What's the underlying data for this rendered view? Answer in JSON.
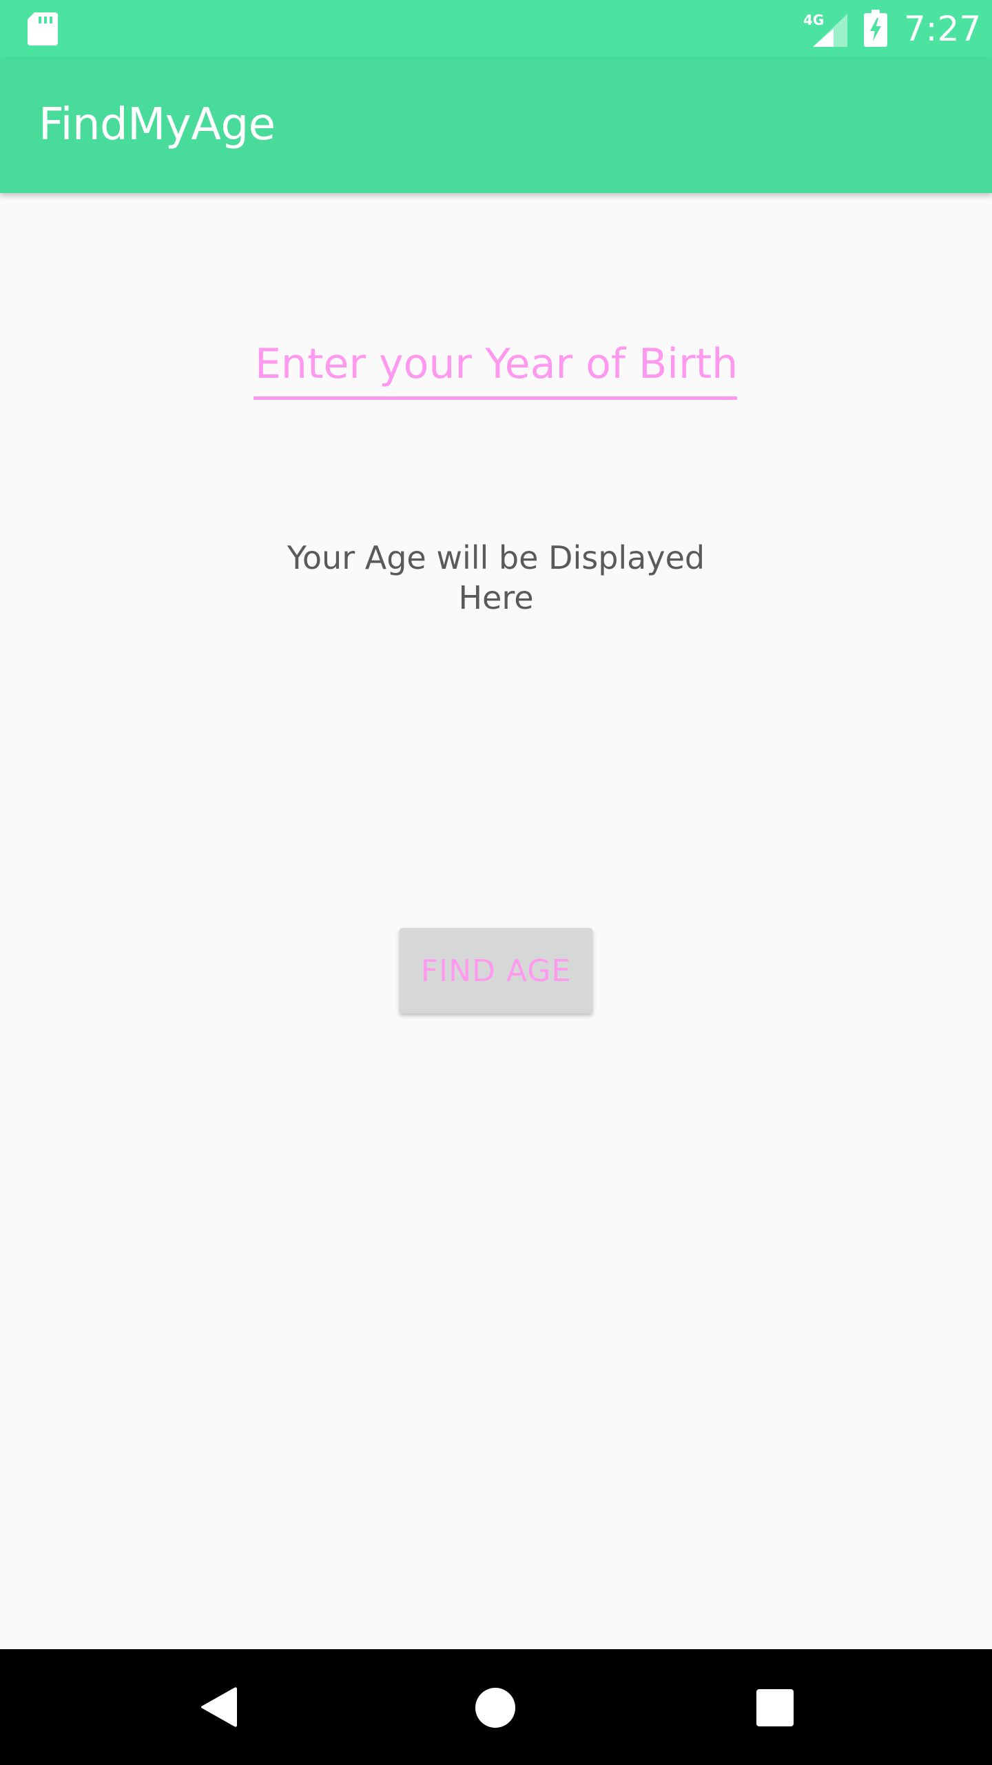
{
  "status_bar": {
    "time": "7:27",
    "network_label": "4G",
    "icons": [
      "sd-card-icon",
      "signal-icon",
      "battery-charging-icon"
    ]
  },
  "app_bar": {
    "title": "FindMyAge"
  },
  "form": {
    "year_input_placeholder": "Enter your Year of Birth",
    "year_input_value": "",
    "age_display": "Your Age will be Displayed Here",
    "find_button_label": "FIND AGE"
  },
  "nav_bar": {
    "icons": [
      "back-icon",
      "home-icon",
      "recent-apps-icon"
    ]
  },
  "colors": {
    "status_bar": "#4be39f",
    "app_bar": "#49db99",
    "accent_pink": "#ff99f0",
    "background": "#fafafa",
    "button_bg": "#d6d7d7"
  }
}
